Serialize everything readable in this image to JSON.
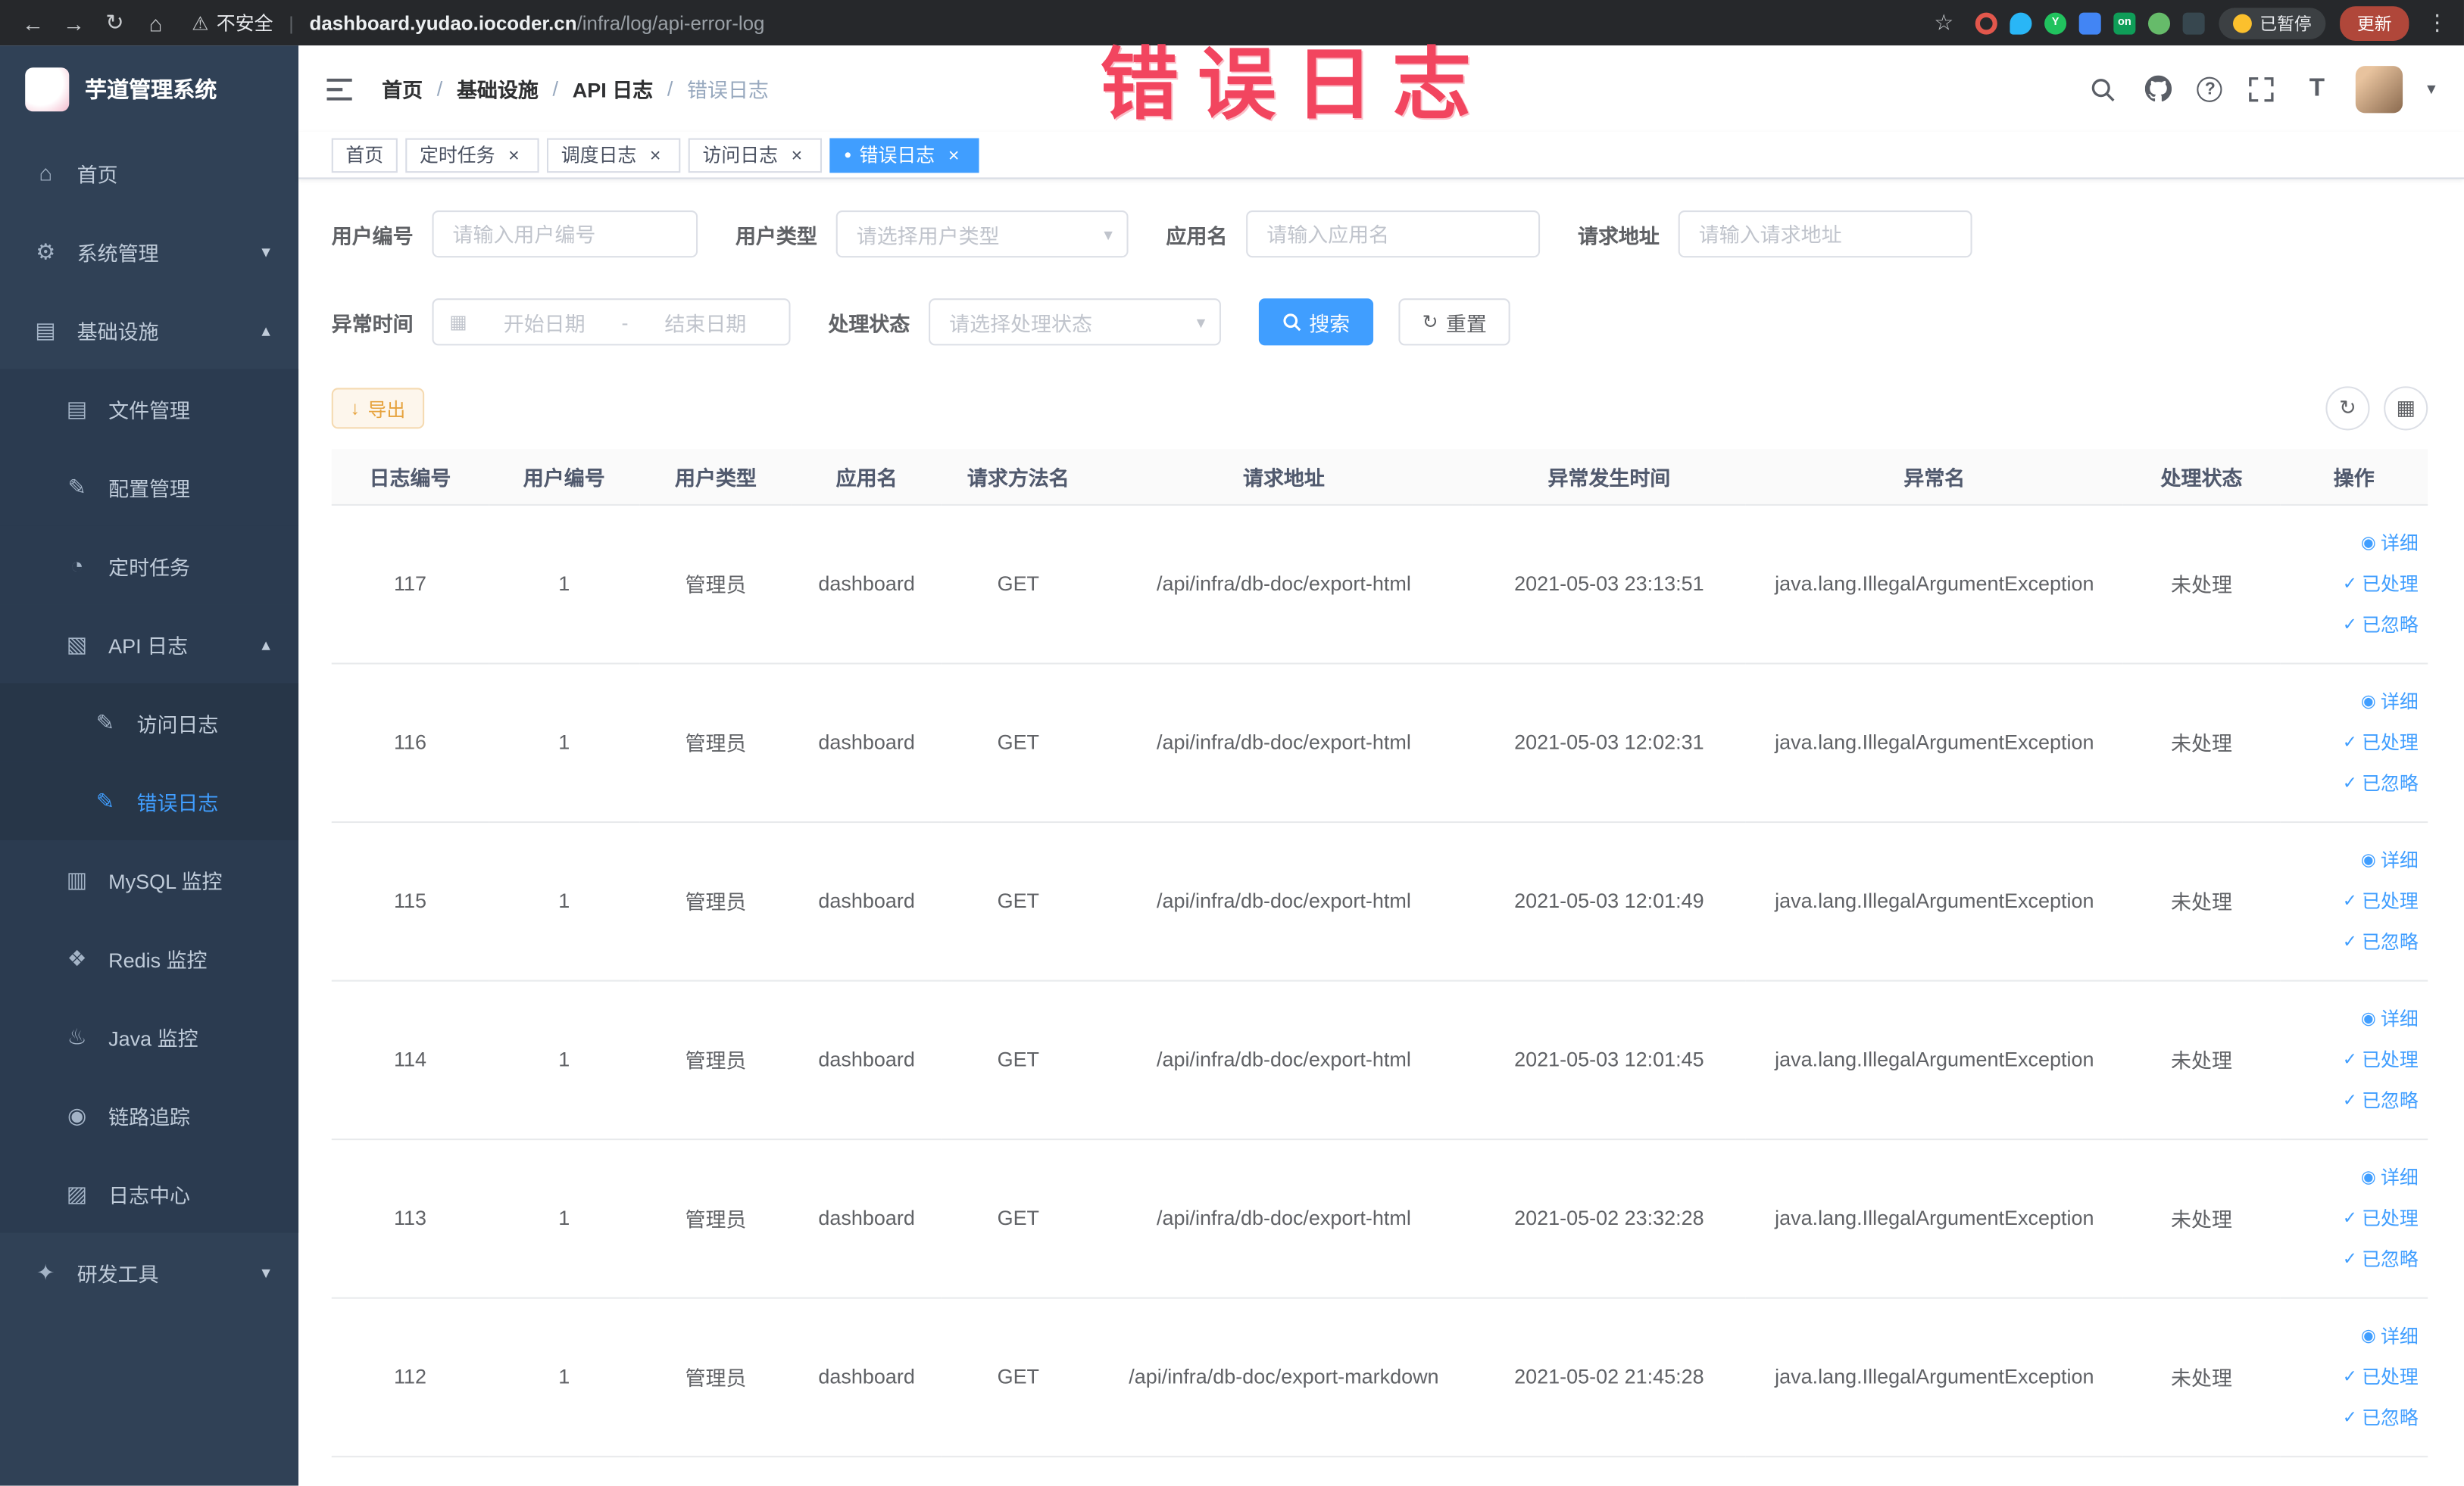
{
  "colors": {
    "accent": "#409eff",
    "sidebar_bg": "#304156",
    "annotation": "#f2455f",
    "warning": "#e6a23c",
    "warning_bg": "#fdf6ec",
    "warning_border": "#f5dab1",
    "border": "#dcdfe6"
  },
  "icons": {
    "back": "←",
    "forward": "→",
    "reload": "↻",
    "home": "⌂",
    "warning": "⚠",
    "star": "☆",
    "kebab": "⋮",
    "caret_down": "▾",
    "chevron_up": "▴",
    "chevron_down": "▾",
    "calendar": "▦",
    "download": "↓",
    "check": "✓",
    "eye": "◉",
    "dot": "●",
    "close": "×",
    "grid": "▦",
    "question": "?",
    "font_size": "T"
  },
  "menu_icon_glyphs": {
    "home-icon": "⌂",
    "gear-icon": "⚙",
    "cube-icon": "▤",
    "folder-icon": "▤",
    "edit-icon": "✎",
    "timer-icon": "◔",
    "log-icon": "▧",
    "doc-edit-icon": "✎",
    "database-icon": "▥",
    "redis-icon": "❖",
    "coffee-icon": "♨",
    "eye-icon": "◉",
    "log-center-icon": "▨",
    "tools-icon": "✦"
  },
  "browser": {
    "security": "不安全",
    "url_separator": "|",
    "url_domain": "dashboard.yudao.iocoder.cn",
    "url_path": "/infra/log/api-error-log",
    "paused": "已暂停",
    "update": "更新",
    "extensions": [
      {
        "color": "#e2574c",
        "shape": "ring",
        "text": ""
      },
      {
        "color": "#29b6f6",
        "shape": "drop",
        "text": ""
      },
      {
        "color": "#21c25e",
        "shape": "circle",
        "text": "Y"
      },
      {
        "color": "#4285f4",
        "shape": "square",
        "text": ""
      },
      {
        "color": "#0f9d58",
        "shape": "square",
        "text": "on"
      },
      {
        "color": "#66bb6a",
        "shape": "circle",
        "text": ""
      },
      {
        "color": "#37474f",
        "shape": "square",
        "text": ""
      }
    ]
  },
  "annotation": "错误日志",
  "sidebar": {
    "title": "芋道管理系统",
    "menu": [
      {
        "key": "home",
        "label": "首页",
        "icon": "home-icon",
        "level": 1
      },
      {
        "key": "system-manage",
        "label": "系统管理",
        "icon": "gear-icon",
        "level": 1,
        "arrow": "down"
      },
      {
        "key": "infra",
        "label": "基础设施",
        "icon": "cube-icon",
        "level": 1,
        "arrow": "up"
      },
      {
        "key": "file-manage",
        "label": "文件管理",
        "icon": "folder-icon",
        "level": 2
      },
      {
        "key": "config-manage",
        "label": "配置管理",
        "icon": "edit-icon",
        "level": 2
      },
      {
        "key": "cron-job",
        "label": "定时任务",
        "icon": "timer-icon",
        "level": 2
      },
      {
        "key": "api-log",
        "label": "API 日志",
        "icon": "log-icon",
        "level": 2,
        "arrow": "up"
      },
      {
        "key": "access-log",
        "label": "访问日志",
        "icon": "doc-edit-icon",
        "level": 3
      },
      {
        "key": "error-log",
        "label": "错误日志",
        "icon": "doc-edit-icon",
        "level": 3,
        "active": true
      },
      {
        "key": "mysql-monitor",
        "label": "MySQL 监控",
        "icon": "database-icon",
        "level": 2
      },
      {
        "key": "redis-monitor",
        "label": "Redis 监控",
        "icon": "redis-icon",
        "level": 2
      },
      {
        "key": "java-monitor",
        "label": "Java 监控",
        "icon": "coffee-icon",
        "level": 2
      },
      {
        "key": "trace",
        "label": "链路追踪",
        "icon": "eye-icon",
        "level": 2
      },
      {
        "key": "log-center",
        "label": "日志中心",
        "icon": "log-center-icon",
        "level": 2
      },
      {
        "key": "dev-tools",
        "label": "研发工具",
        "icon": "tools-icon",
        "level": 1,
        "arrow": "down"
      }
    ]
  },
  "breadcrumb": {
    "separator": "/",
    "items": [
      "首页",
      "基础设施",
      "API 日志",
      "错误日志"
    ]
  },
  "tabs": [
    {
      "key": "home",
      "label": "首页",
      "closable": false,
      "active": false
    },
    {
      "key": "cron-job",
      "label": "定时任务",
      "closable": true,
      "active": false
    },
    {
      "key": "job-log",
      "label": "调度日志",
      "closable": true,
      "active": false
    },
    {
      "key": "access-log",
      "label": "访问日志",
      "closable": true,
      "active": false
    },
    {
      "key": "error-log",
      "label": "错误日志",
      "closable": true,
      "active": true
    }
  ],
  "filters": {
    "user_id_label": "用户编号",
    "user_id_placeholder": "请输入用户编号",
    "user_type_label": "用户类型",
    "user_type_placeholder": "请选择用户类型",
    "app_label": "应用名",
    "app_placeholder": "请输入应用名",
    "url_label": "请求地址",
    "url_placeholder": "请输入请求地址",
    "time_label": "异常时间",
    "time_start_placeholder": "开始日期",
    "time_separator": "-",
    "time_end_placeholder": "结束日期",
    "status_label": "处理状态",
    "status_placeholder": "请选择处理状态",
    "search": "搜索",
    "reset": "重置"
  },
  "toolbar": {
    "export": "导出"
  },
  "table": {
    "columns": [
      "日志编号",
      "用户编号",
      "用户类型",
      "应用名",
      "请求方法名",
      "请求地址",
      "异常发生时间",
      "异常名",
      "处理状态",
      "操作"
    ],
    "row_actions": {
      "detail": "详细",
      "process": "已处理",
      "ignore": "已忽略"
    },
    "rows": [
      {
        "id": "117",
        "user_id": "1",
        "user_type": "管理员",
        "app": "dashboard",
        "method": "GET",
        "url": "/api/infra/db-doc/export-html",
        "time": "2021-05-03 23:13:51",
        "exception": "java.lang.IllegalArgumentException",
        "status": "未处理"
      },
      {
        "id": "116",
        "user_id": "1",
        "user_type": "管理员",
        "app": "dashboard",
        "method": "GET",
        "url": "/api/infra/db-doc/export-html",
        "time": "2021-05-03 12:02:31",
        "exception": "java.lang.IllegalArgumentException",
        "status": "未处理"
      },
      {
        "id": "115",
        "user_id": "1",
        "user_type": "管理员",
        "app": "dashboard",
        "method": "GET",
        "url": "/api/infra/db-doc/export-html",
        "time": "2021-05-03 12:01:49",
        "exception": "java.lang.IllegalArgumentException",
        "status": "未处理"
      },
      {
        "id": "114",
        "user_id": "1",
        "user_type": "管理员",
        "app": "dashboard",
        "method": "GET",
        "url": "/api/infra/db-doc/export-html",
        "time": "2021-05-03 12:01:45",
        "exception": "java.lang.IllegalArgumentException",
        "status": "未处理"
      },
      {
        "id": "113",
        "user_id": "1",
        "user_type": "管理员",
        "app": "dashboard",
        "method": "GET",
        "url": "/api/infra/db-doc/export-html",
        "time": "2021-05-02 23:32:28",
        "exception": "java.lang.IllegalArgumentException",
        "status": "未处理"
      },
      {
        "id": "112",
        "user_id": "1",
        "user_type": "管理员",
        "app": "dashboard",
        "method": "GET",
        "url": "/api/infra/db-doc/export-markdown",
        "time": "2021-05-02 21:45:28",
        "exception": "java.lang.IllegalArgumentException",
        "status": "未处理"
      }
    ]
  }
}
